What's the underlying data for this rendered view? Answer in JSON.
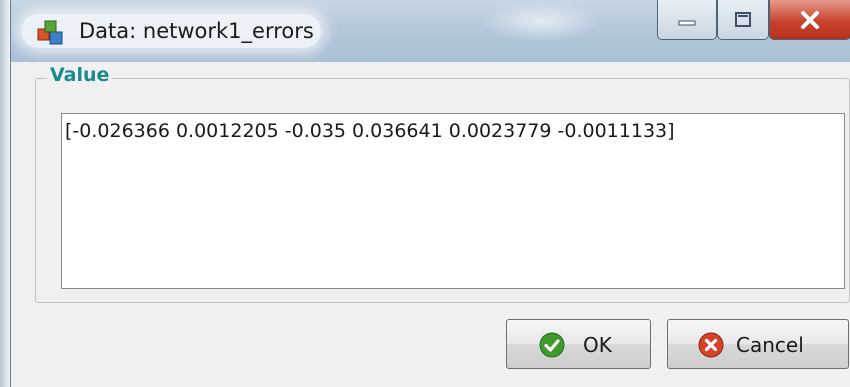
{
  "window": {
    "title": "Data: network1_errors",
    "controls": [
      "minimize-icon",
      "maximize-icon",
      "close-icon"
    ]
  },
  "group": {
    "legend": "Value",
    "value_text": "[-0.026366 0.0012205 -0.035 0.036641 0.0023779 -0.0011133]"
  },
  "buttons": {
    "ok_label": "OK",
    "cancel_label": "Cancel"
  },
  "colors": {
    "legend": "#1b8a8d",
    "ok_icon": "#3f9a2c",
    "cancel_icon": "#d4422a",
    "close_button": "#c8432f"
  }
}
